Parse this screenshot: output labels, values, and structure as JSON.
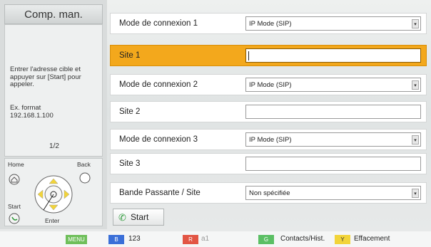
{
  "left_panel": {
    "title": "Comp. man.",
    "instruction": "Entrer l'adresse cible et appuyer sur [Start] pour appeler.",
    "format_label": "Ex. format",
    "format_example": "192.168.1.100",
    "page_indicator": "1/2"
  },
  "remote": {
    "home_label": "Home",
    "back_label": "Back",
    "start_label": "Start",
    "enter_label": "Enter"
  },
  "form": {
    "rows": [
      {
        "label": "Mode de connexion 1",
        "type": "select",
        "value": "IP Mode (SIP)"
      },
      {
        "label": "Site 1",
        "type": "input",
        "value": ""
      },
      {
        "label": "Mode de connexion 2",
        "type": "select",
        "value": "IP Mode (SIP)"
      },
      {
        "label": "Site 2",
        "type": "input",
        "value": ""
      },
      {
        "label": "Mode de connexion 3",
        "type": "select",
        "value": "IP Mode (SIP)"
      },
      {
        "label": "Site 3",
        "type": "input",
        "value": ""
      },
      {
        "label": "Bande Passante / Site",
        "type": "select",
        "value": "Non spécifiée"
      }
    ],
    "start_label": "Start"
  },
  "bottom_bar": {
    "menu_key": "MENU",
    "blue_key": "B",
    "blue_text": "123",
    "red_key": "R",
    "red_text": "a1",
    "green_key": "G",
    "green_text": "Contacts/Hist.",
    "yellow_key": "Y",
    "yellow_text": "Effacement"
  },
  "colors": {
    "selected_row": "#f3a81c",
    "menu_key": "#6fbf5a",
    "blue_key": "#3a6fd8",
    "red_key": "#e25544",
    "green_key": "#5bbf64",
    "yellow_key": "#f2d43a"
  }
}
